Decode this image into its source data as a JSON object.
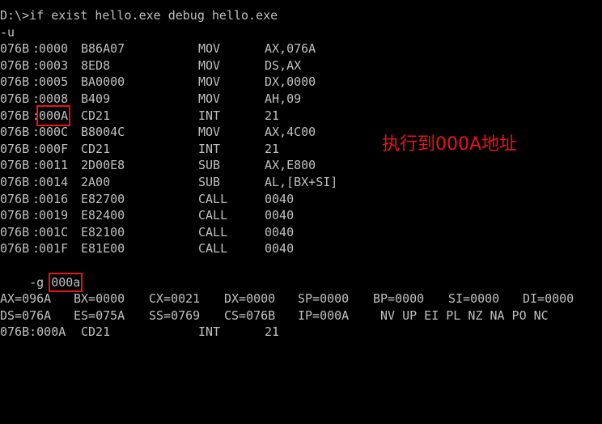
{
  "console": {
    "command": "D:\\>if exist hello.exe debug hello.exe",
    "unassemble_cmd": "-u",
    "disasm": [
      {
        "seg": "076B",
        "off": "0000",
        "hex": "B86A07",
        "mnem": "MOV",
        "ops": "AX,076A"
      },
      {
        "seg": "076B",
        "off": "0003",
        "hex": "8ED8",
        "mnem": "MOV",
        "ops": "DS,AX"
      },
      {
        "seg": "076B",
        "off": "0005",
        "hex": "BA0000",
        "mnem": "MOV",
        "ops": "DX,0000"
      },
      {
        "seg": "076B",
        "off": "0008",
        "hex": "B409",
        "mnem": "MOV",
        "ops": "AH,09"
      },
      {
        "seg": "076B",
        "off": "000A",
        "hex": "CD21",
        "mnem": "INT",
        "ops": "21"
      },
      {
        "seg": "076B",
        "off": "000C",
        "hex": "B8004C",
        "mnem": "MOV",
        "ops": "AX,4C00"
      },
      {
        "seg": "076B",
        "off": "000F",
        "hex": "CD21",
        "mnem": "INT",
        "ops": "21"
      },
      {
        "seg": "076B",
        "off": "0011",
        "hex": "2D00E8",
        "mnem": "SUB",
        "ops": "AX,E800"
      },
      {
        "seg": "076B",
        "off": "0014",
        "hex": "2A00",
        "mnem": "SUB",
        "ops": "AL,[BX+SI]"
      },
      {
        "seg": "076B",
        "off": "0016",
        "hex": "E82700",
        "mnem": "CALL",
        "ops": "0040"
      },
      {
        "seg": "076B",
        "off": "0019",
        "hex": "E82400",
        "mnem": "CALL",
        "ops": "0040"
      },
      {
        "seg": "076B",
        "off": "001C",
        "hex": "E82100",
        "mnem": "CALL",
        "ops": "0040"
      },
      {
        "seg": "076B",
        "off": "001F",
        "hex": "E81E00",
        "mnem": "CALL",
        "ops": "0040"
      }
    ],
    "go_prefix": "-g ",
    "go_arg": "000a",
    "registers_row1": [
      "AX=096A",
      "BX=0000",
      "CX=0021",
      "DX=0000",
      "SP=0000",
      "BP=0000",
      "SI=0000",
      "DI=0000"
    ],
    "registers_row2": [
      "DS=076A",
      "ES=075A",
      "SS=0769",
      "CS=076B",
      "IP=000A"
    ],
    "flags": "NV UP EI PL NZ NA PO NC",
    "current": {
      "addr": "076B:000A",
      "hex": "CD21",
      "mnem": "INT",
      "ops": "21"
    }
  },
  "annotation": {
    "text": "执行到000A地址"
  },
  "colors": {
    "background": "#000000",
    "console_text": "#c0c0c0",
    "highlight": "#e8141a"
  }
}
